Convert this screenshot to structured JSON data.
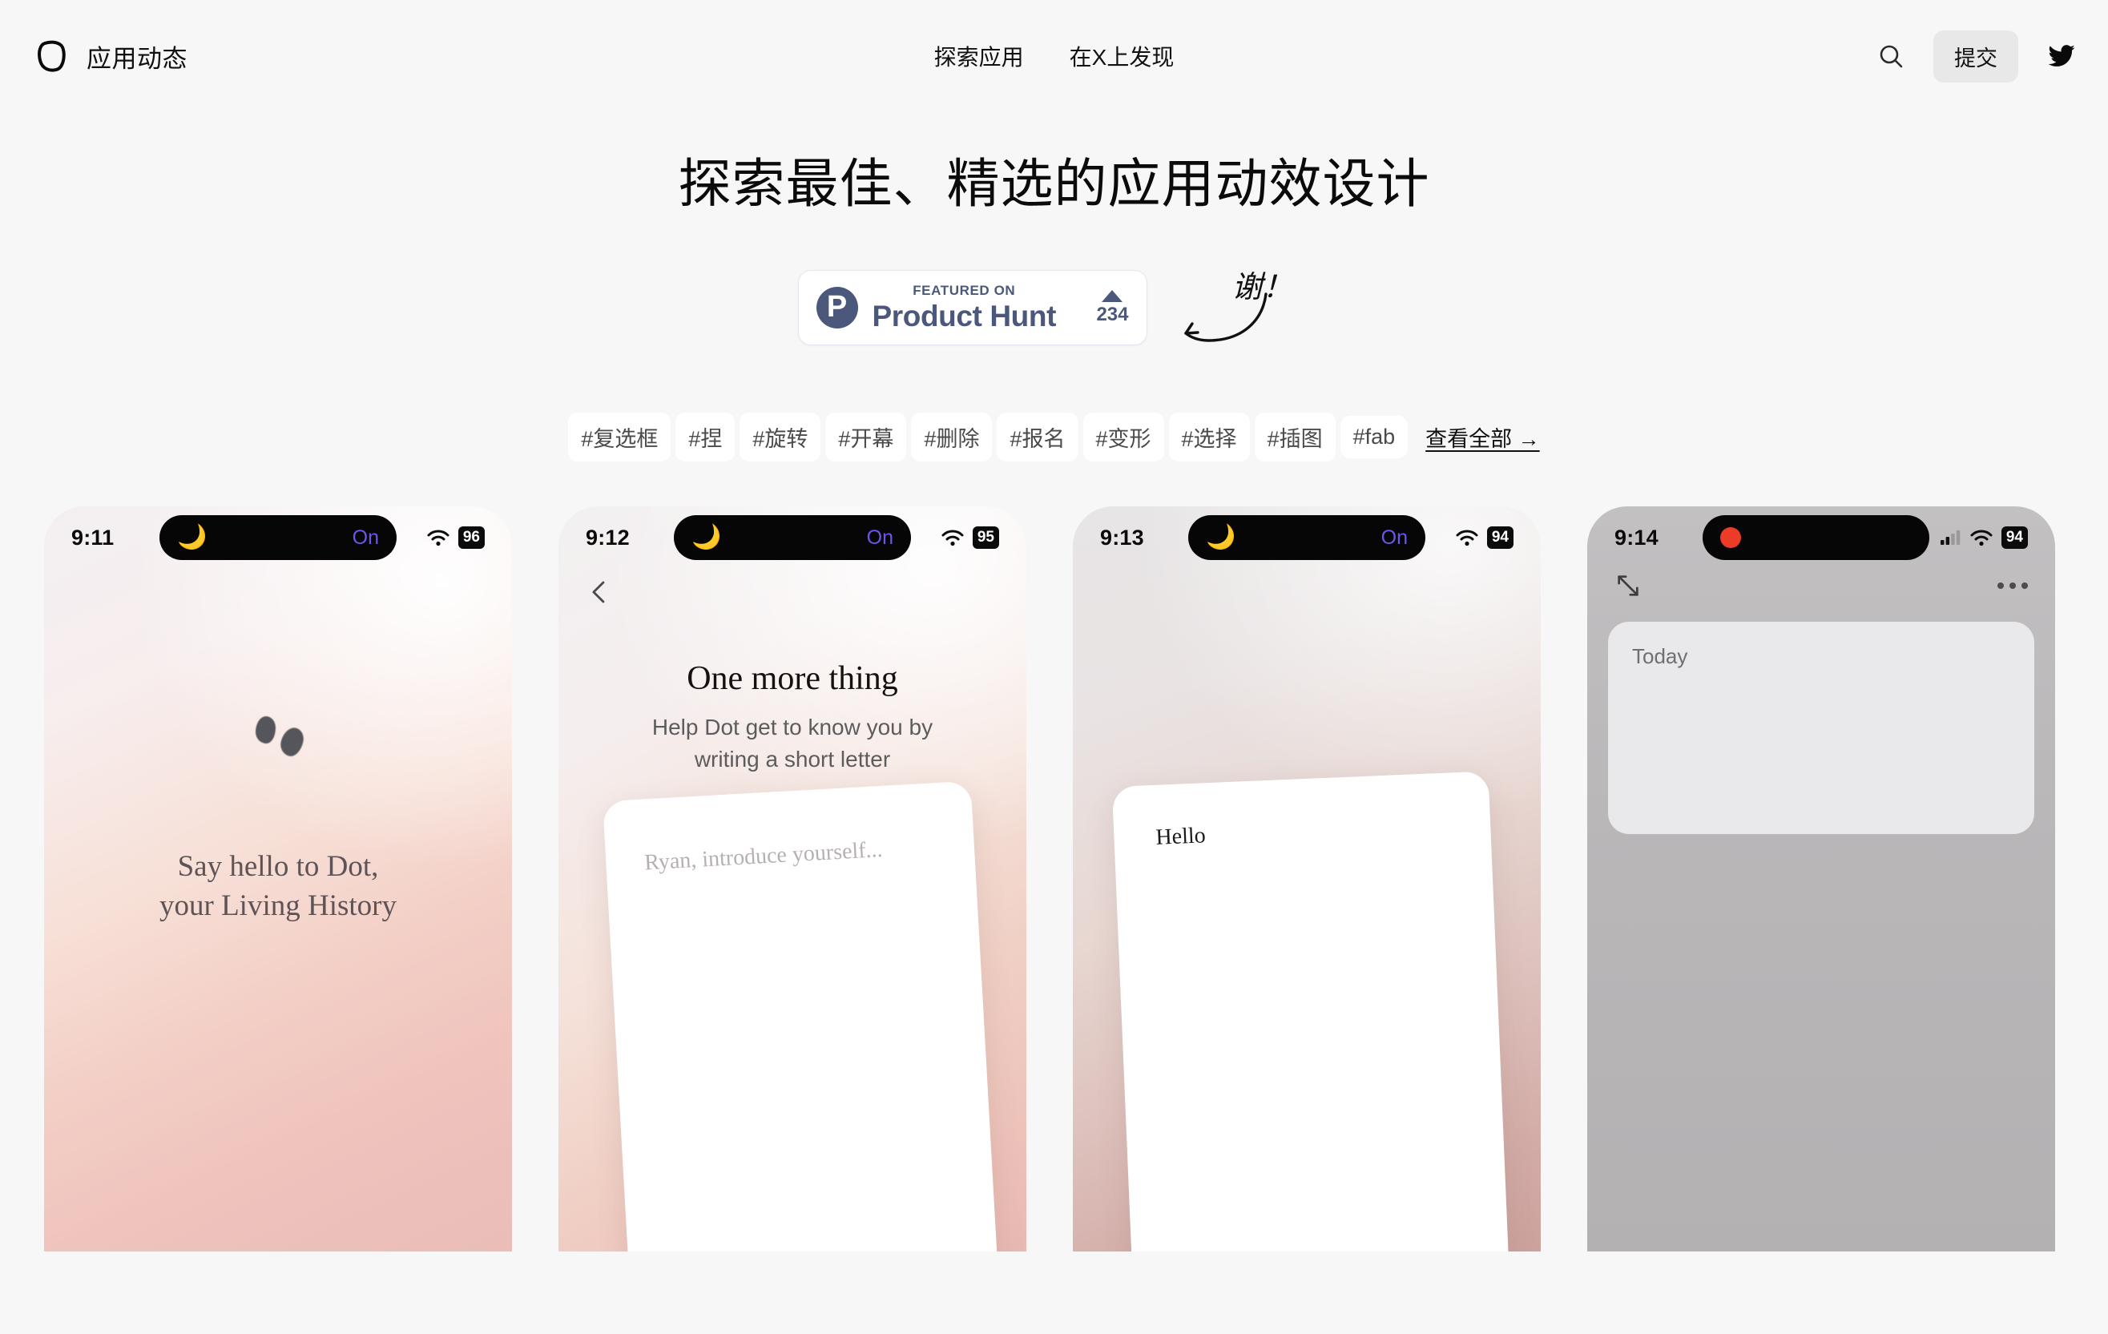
{
  "header": {
    "brand": "应用动态",
    "nav": [
      {
        "label": "探索应用"
      },
      {
        "label": "在X上发现"
      }
    ],
    "search_icon": "search-icon",
    "submit_label": "提交",
    "twitter_icon": "twitter-icon"
  },
  "hero": {
    "title": "探索最佳、精选的应用动效设计",
    "product_hunt": {
      "featured_on": "FEATURED ON",
      "name": "Product Hunt",
      "votes": "234",
      "logo_letter": "P",
      "brand_color": "#4b587c"
    },
    "thanks": "谢！"
  },
  "tags": {
    "items": [
      {
        "label": "#复选框"
      },
      {
        "label": "#捏"
      },
      {
        "label": "#旋转"
      },
      {
        "label": "#开幕"
      },
      {
        "label": "#删除"
      },
      {
        "label": "#报名"
      },
      {
        "label": "#变形"
      },
      {
        "label": "#选择"
      },
      {
        "label": "#插图"
      },
      {
        "label": "#fab"
      }
    ],
    "see_all": "查看全部 →"
  },
  "cards": [
    {
      "time": "9:11",
      "island_label": "On",
      "battery": "96",
      "title_line1": "Say hello to Dot,",
      "title_line2": "your Living History"
    },
    {
      "time": "9:12",
      "island_label": "On",
      "battery": "95",
      "title": "One more thing",
      "subtitle_line1": "Help Dot get to know you by",
      "subtitle_line2": "writing a short letter",
      "note_placeholder": "Ryan, introduce yourself..."
    },
    {
      "time": "9:13",
      "island_label": "On",
      "battery": "94",
      "note_text": "Hello"
    },
    {
      "time": "9:14",
      "battery": "94",
      "today_label": "Today"
    }
  ]
}
